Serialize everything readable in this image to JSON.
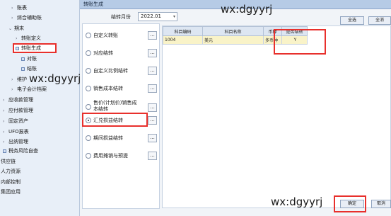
{
  "nav": {
    "items": [
      {
        "label": "账表",
        "arrow": "›"
      },
      {
        "label": "综合辅助账",
        "arrow": "›"
      },
      {
        "label": "期末",
        "arrow": "⌄"
      },
      {
        "label": "转账定义",
        "arrow": "›"
      },
      {
        "label": "转账生成",
        "arrow": ""
      },
      {
        "label": "对账",
        "arrow": ""
      },
      {
        "label": "结账",
        "arrow": ""
      },
      {
        "label": "维护",
        "arrow": "›"
      },
      {
        "label": "电子会计档案",
        "arrow": "›"
      },
      {
        "label": "应收款管理",
        "arrow": "›"
      },
      {
        "label": "应付款管理",
        "arrow": "›"
      },
      {
        "label": "固定资产",
        "arrow": "›"
      },
      {
        "label": "UFO报表",
        "arrow": "›"
      },
      {
        "label": "出纳管理",
        "arrow": "›"
      },
      {
        "label": "税务风险自查",
        "arrow": ""
      },
      {
        "label": "供应链",
        "arrow": ""
      },
      {
        "label": "人力资源",
        "arrow": ""
      },
      {
        "label": "内部控制",
        "arrow": ""
      },
      {
        "label": "集团应用",
        "arrow": ""
      }
    ]
  },
  "dialog": {
    "title": "转账生成",
    "period_label": "结转月份",
    "period_value": "2022.01",
    "dropdown_glyph": "▾",
    "select_all": "全选",
    "deselect_all": "全消",
    "ellipsis": "...",
    "confirm": "确定",
    "cancel": "取消"
  },
  "options": [
    {
      "label": "自定义转账",
      "selected": false
    },
    {
      "label": "对应结转",
      "selected": false
    },
    {
      "label": "自定义比例结转",
      "selected": false
    },
    {
      "label": "销售成本结转",
      "selected": false
    },
    {
      "label": "售价(计划价)销售成本结转",
      "selected": false
    },
    {
      "label": "汇兑损益结转",
      "selected": true
    },
    {
      "label": "期间损益结转",
      "selected": false
    },
    {
      "label": "费用摊销与预提",
      "selected": false
    }
  ],
  "grid": {
    "columns": [
      "科目编码",
      "科目名称",
      "币种",
      "是否结转"
    ],
    "rows": [
      [
        "1004",
        "美元",
        "多币种",
        "Y"
      ]
    ]
  },
  "watermarks": [
    "wx:dgyyrj",
    "wx:dgyyrj",
    "wx:dgyyrj"
  ]
}
